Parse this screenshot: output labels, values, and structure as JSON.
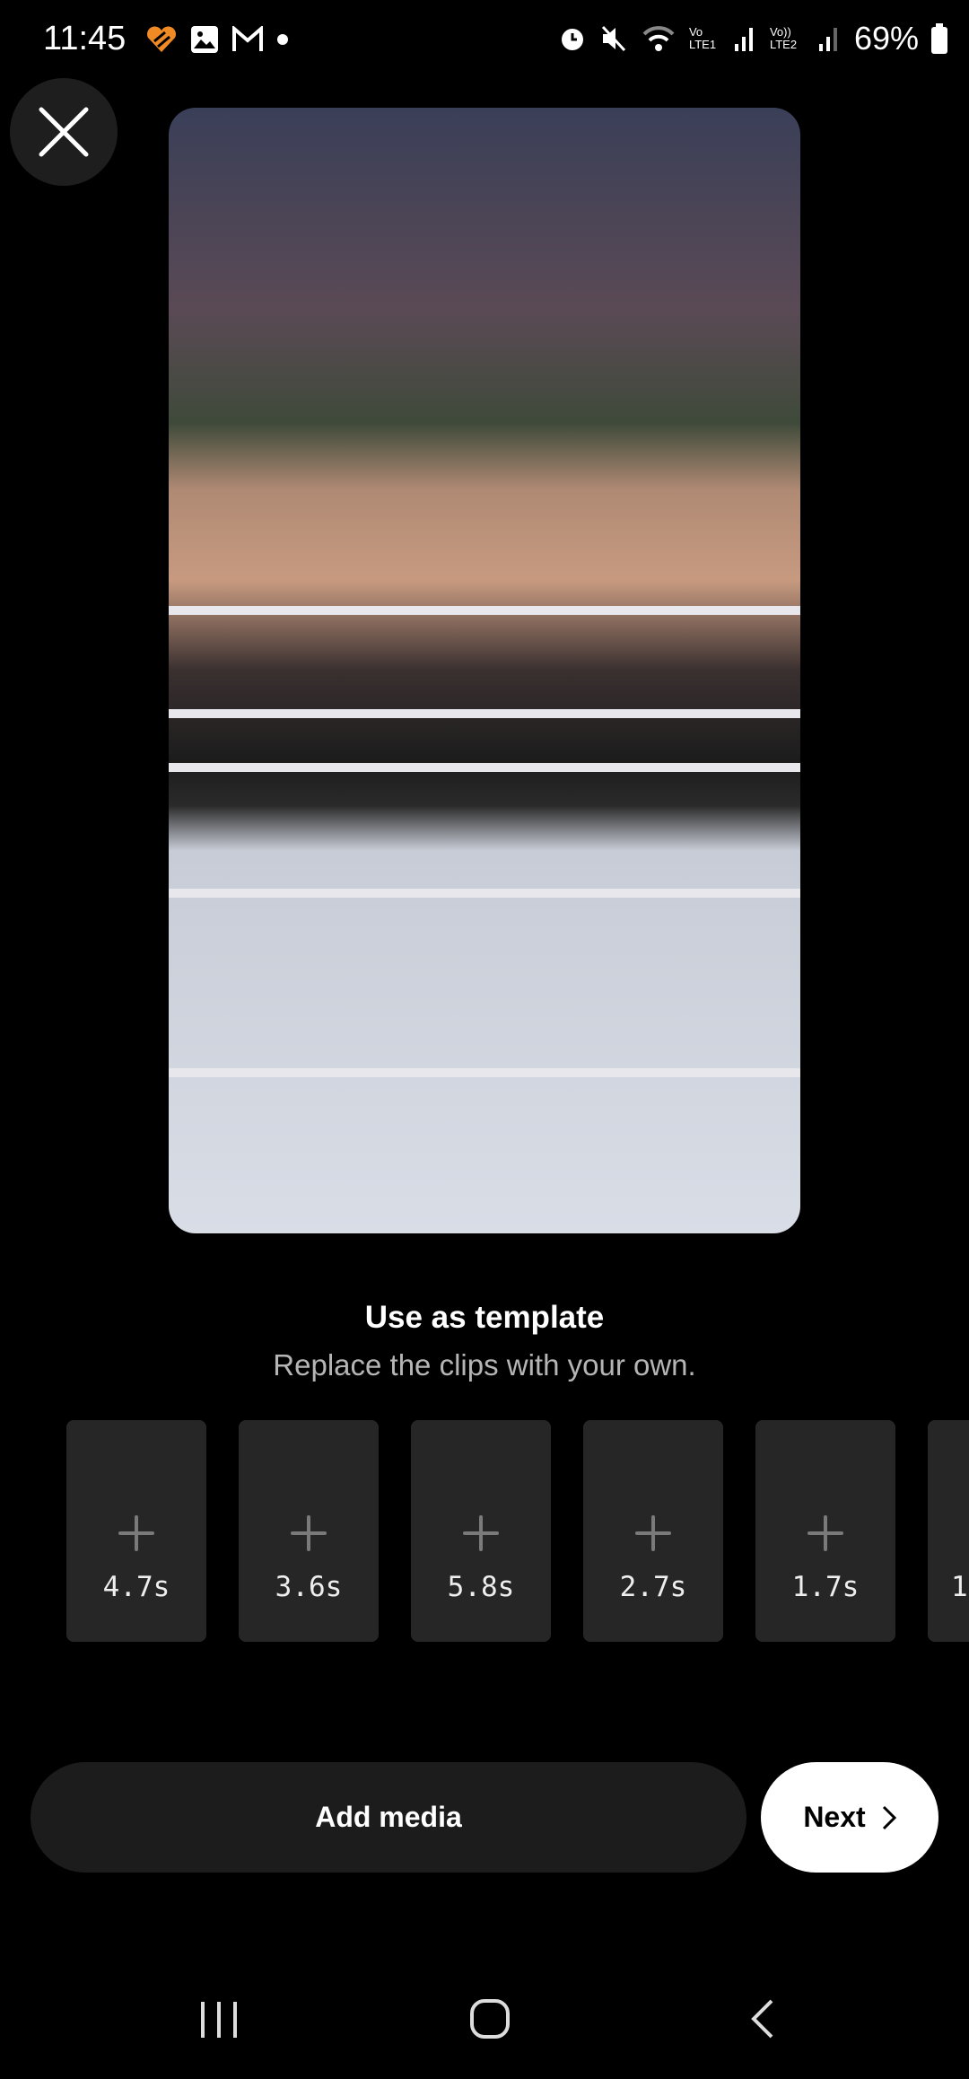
{
  "status_bar": {
    "time": "11:45",
    "battery": "69%",
    "icons": [
      "heart-app-icon",
      "gallery-icon",
      "gmail-icon",
      "dot-icon",
      "alarm-icon",
      "mute-icon",
      "wifi-icon",
      "signal-lte1-icon",
      "signal-lte2-icon",
      "battery-icon"
    ],
    "lte1": "Vo LTE1",
    "lte2": "Vo)) LTE2"
  },
  "close_icon": "close-icon",
  "media": {
    "description_icon": "video-preview"
  },
  "template": {
    "title": "Use as template",
    "subtitle": "Replace the clips with your own."
  },
  "clips": [
    {
      "duration": "4.7s"
    },
    {
      "duration": "3.6s"
    },
    {
      "duration": "5.8s"
    },
    {
      "duration": "2.7s"
    },
    {
      "duration": "1.7s"
    },
    {
      "duration": "1"
    }
  ],
  "actions": {
    "add_media": "Add media",
    "next": "Next"
  },
  "colors": {
    "background": "#000000",
    "tile": "#262626",
    "button_dark": "#1c1c1c",
    "button_light": "#ffffff",
    "accent_orange": "#f08a24"
  }
}
